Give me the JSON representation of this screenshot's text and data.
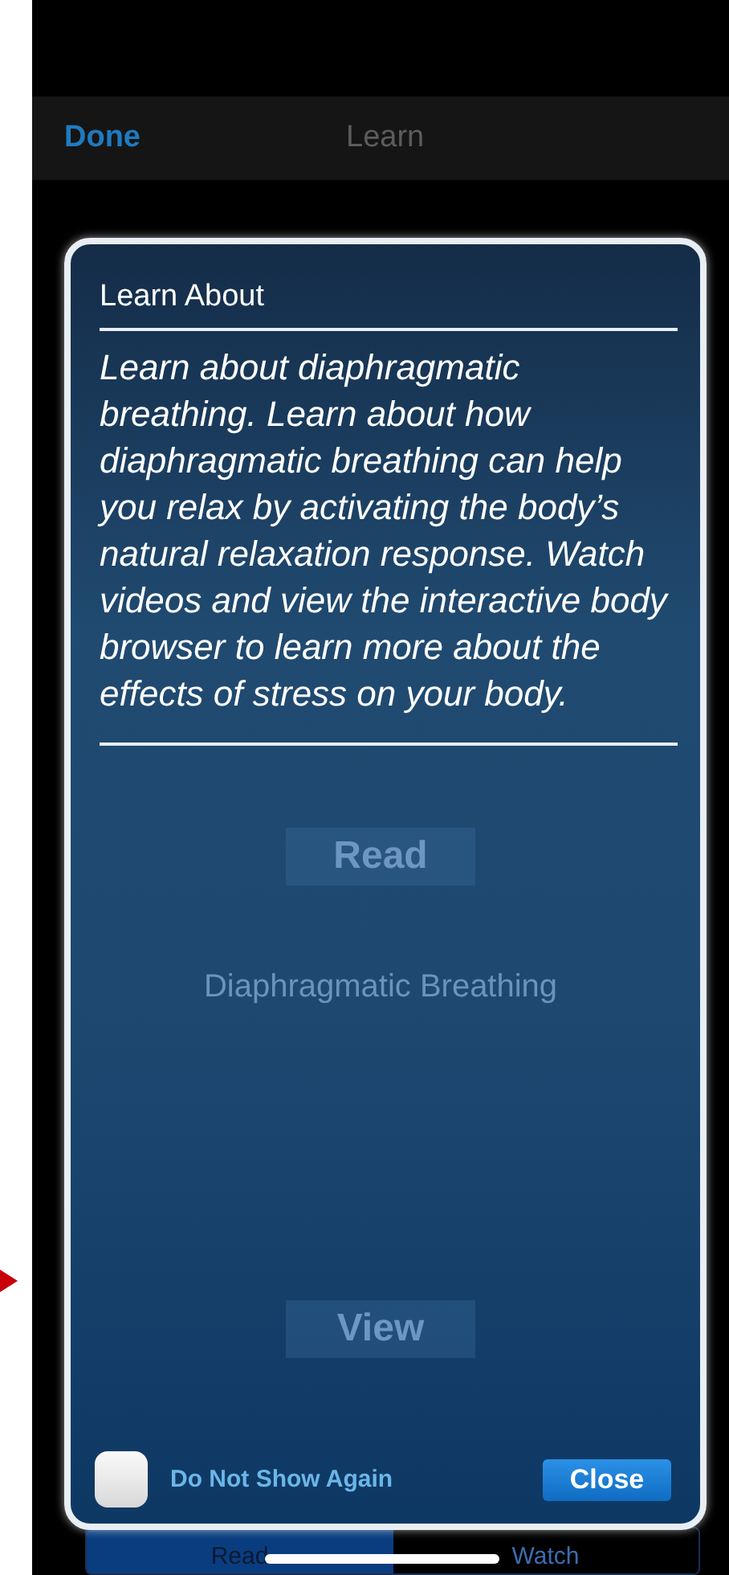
{
  "nav": {
    "left_button": "Done",
    "title": "Learn"
  },
  "background_sections": [
    {
      "button": "Read",
      "title": "Diaphragmatic Breathing"
    },
    {
      "button": "View"
    }
  ],
  "tabs": [
    {
      "label": "Read",
      "selected": true
    },
    {
      "label": "Watch",
      "selected": false
    }
  ],
  "dialog": {
    "title": "Learn About",
    "body": "Learn about diaphragmatic breathing. Learn about how diaphragmatic breathing can help you relax by activating the body’s natural relaxation response. Watch videos and view the interactive body browser to learn more about the effects of stress on your body.",
    "checkbox": {
      "label": "Do Not Show Again",
      "checked": false
    },
    "close_button": "Close"
  }
}
